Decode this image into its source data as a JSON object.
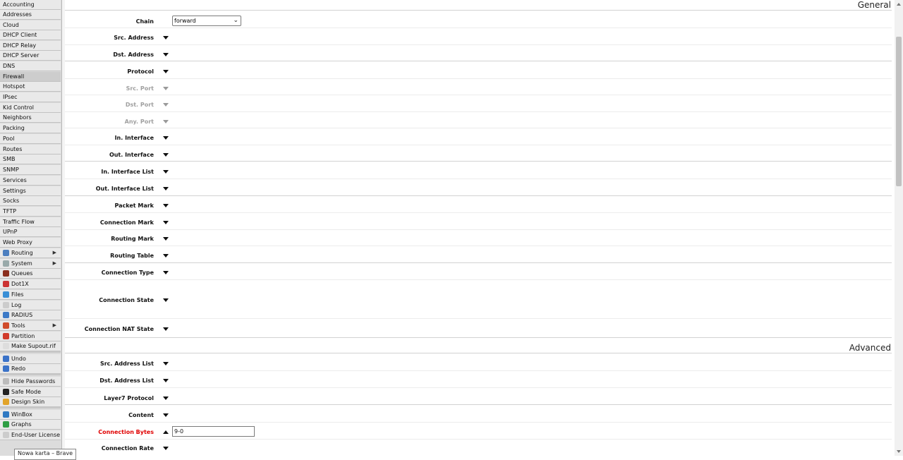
{
  "sidebar": {
    "items": [
      {
        "label": "Accounting",
        "icon": "",
        "submenu": false
      },
      {
        "label": "Addresses",
        "icon": "",
        "submenu": false
      },
      {
        "label": "Cloud",
        "icon": "",
        "submenu": false
      },
      {
        "label": "DHCP Client",
        "icon": "",
        "submenu": false
      },
      {
        "label": "DHCP Relay",
        "icon": "",
        "submenu": false
      },
      {
        "label": "DHCP Server",
        "icon": "",
        "submenu": false
      },
      {
        "label": "DNS",
        "icon": "",
        "submenu": false
      },
      {
        "label": "Firewall",
        "icon": "",
        "submenu": false,
        "active": true
      },
      {
        "label": "Hotspot",
        "icon": "",
        "submenu": false
      },
      {
        "label": "IPsec",
        "icon": "",
        "submenu": false
      },
      {
        "label": "Kid Control",
        "icon": "",
        "submenu": false
      },
      {
        "label": "Neighbors",
        "icon": "",
        "submenu": false
      },
      {
        "label": "Packing",
        "icon": "",
        "submenu": false
      },
      {
        "label": "Pool",
        "icon": "",
        "submenu": false
      },
      {
        "label": "Routes",
        "icon": "",
        "submenu": false
      },
      {
        "label": "SMB",
        "icon": "",
        "submenu": false
      },
      {
        "label": "SNMP",
        "icon": "",
        "submenu": false
      },
      {
        "label": "Services",
        "icon": "",
        "submenu": false
      },
      {
        "label": "Settings",
        "icon": "",
        "submenu": false
      },
      {
        "label": "Socks",
        "icon": "",
        "submenu": false
      },
      {
        "label": "TFTP",
        "icon": "",
        "submenu": false
      },
      {
        "label": "Traffic Flow",
        "icon": "",
        "submenu": false
      },
      {
        "label": "UPnP",
        "icon": "",
        "submenu": false
      },
      {
        "label": "Web Proxy",
        "icon": "",
        "submenu": false
      },
      {
        "label": "Routing",
        "icon": "routing-icon",
        "submenu": true
      },
      {
        "label": "System",
        "icon": "gear-icon",
        "submenu": true
      },
      {
        "label": "Queues",
        "icon": "queues-icon",
        "submenu": false
      },
      {
        "label": "Dot1X",
        "icon": "dot1x-icon",
        "submenu": false
      },
      {
        "label": "Files",
        "icon": "folder-icon",
        "submenu": false
      },
      {
        "label": "Log",
        "icon": "log-icon",
        "submenu": false
      },
      {
        "label": "RADIUS",
        "icon": "users-icon",
        "submenu": false
      },
      {
        "label": "Tools",
        "icon": "tools-icon",
        "submenu": true
      },
      {
        "label": "Partition",
        "icon": "pie-icon",
        "submenu": false
      },
      {
        "label": "Make Supout.rif",
        "icon": "document-icon",
        "submenu": false
      },
      {
        "label": "Undo",
        "icon": "undo-icon",
        "submenu": false
      },
      {
        "label": "Redo",
        "icon": "redo-icon",
        "submenu": false
      },
      {
        "label": "Hide Passwords",
        "icon": "password-icon",
        "submenu": false
      },
      {
        "label": "Safe Mode",
        "icon": "umbrella-icon",
        "submenu": false
      },
      {
        "label": "Design Skin",
        "icon": "palette-icon",
        "submenu": false
      },
      {
        "label": "WinBox",
        "icon": "winbox-icon",
        "submenu": false
      },
      {
        "label": "Graphs",
        "icon": "graph-icon",
        "submenu": false
      },
      {
        "label": "End-User License",
        "icon": "license-icon",
        "submenu": false
      }
    ],
    "submenu_arrow": "▶"
  },
  "sections": {
    "general": "General",
    "advanced": "Advanced"
  },
  "form": {
    "chain": {
      "label": "Chain",
      "value": "forward"
    },
    "general_fields": [
      {
        "label": "Src. Address",
        "state": "normal"
      },
      {
        "label": "Dst. Address",
        "state": "normal"
      },
      {
        "label": "Protocol",
        "state": "normal"
      },
      {
        "label": "Src. Port",
        "state": "disabled"
      },
      {
        "label": "Dst. Port",
        "state": "disabled"
      },
      {
        "label": "Any. Port",
        "state": "disabled"
      },
      {
        "label": "In. Interface",
        "state": "normal"
      },
      {
        "label": "Out. Interface",
        "state": "normal"
      },
      {
        "label": "In. Interface List",
        "state": "normal"
      },
      {
        "label": "Out. Interface List",
        "state": "normal"
      },
      {
        "label": "Packet Mark",
        "state": "normal"
      },
      {
        "label": "Connection Mark",
        "state": "normal"
      },
      {
        "label": "Routing Mark",
        "state": "normal"
      },
      {
        "label": "Routing Table",
        "state": "normal"
      },
      {
        "label": "Connection Type",
        "state": "normal"
      },
      {
        "label": "Connection State",
        "state": "normal"
      },
      {
        "label": "Connection NAT State",
        "state": "normal"
      }
    ],
    "advanced_fields": [
      {
        "label": "Src. Address List",
        "state": "normal"
      },
      {
        "label": "Dst. Address List",
        "state": "normal"
      },
      {
        "label": "Layer7 Protocol",
        "state": "normal"
      },
      {
        "label": "Content",
        "state": "normal"
      },
      {
        "label": "Connection Bytes",
        "state": "expanded",
        "value": "9-0"
      },
      {
        "label": "Connection Rate",
        "state": "normal"
      }
    ]
  },
  "tooltip": "Nowa karta – Brave",
  "colors": {
    "sidebar_bg": "#e9e9e9",
    "active_item": "#cdcdcd",
    "highlight_label": "#e00000",
    "disabled_label": "#a0a0a0"
  }
}
